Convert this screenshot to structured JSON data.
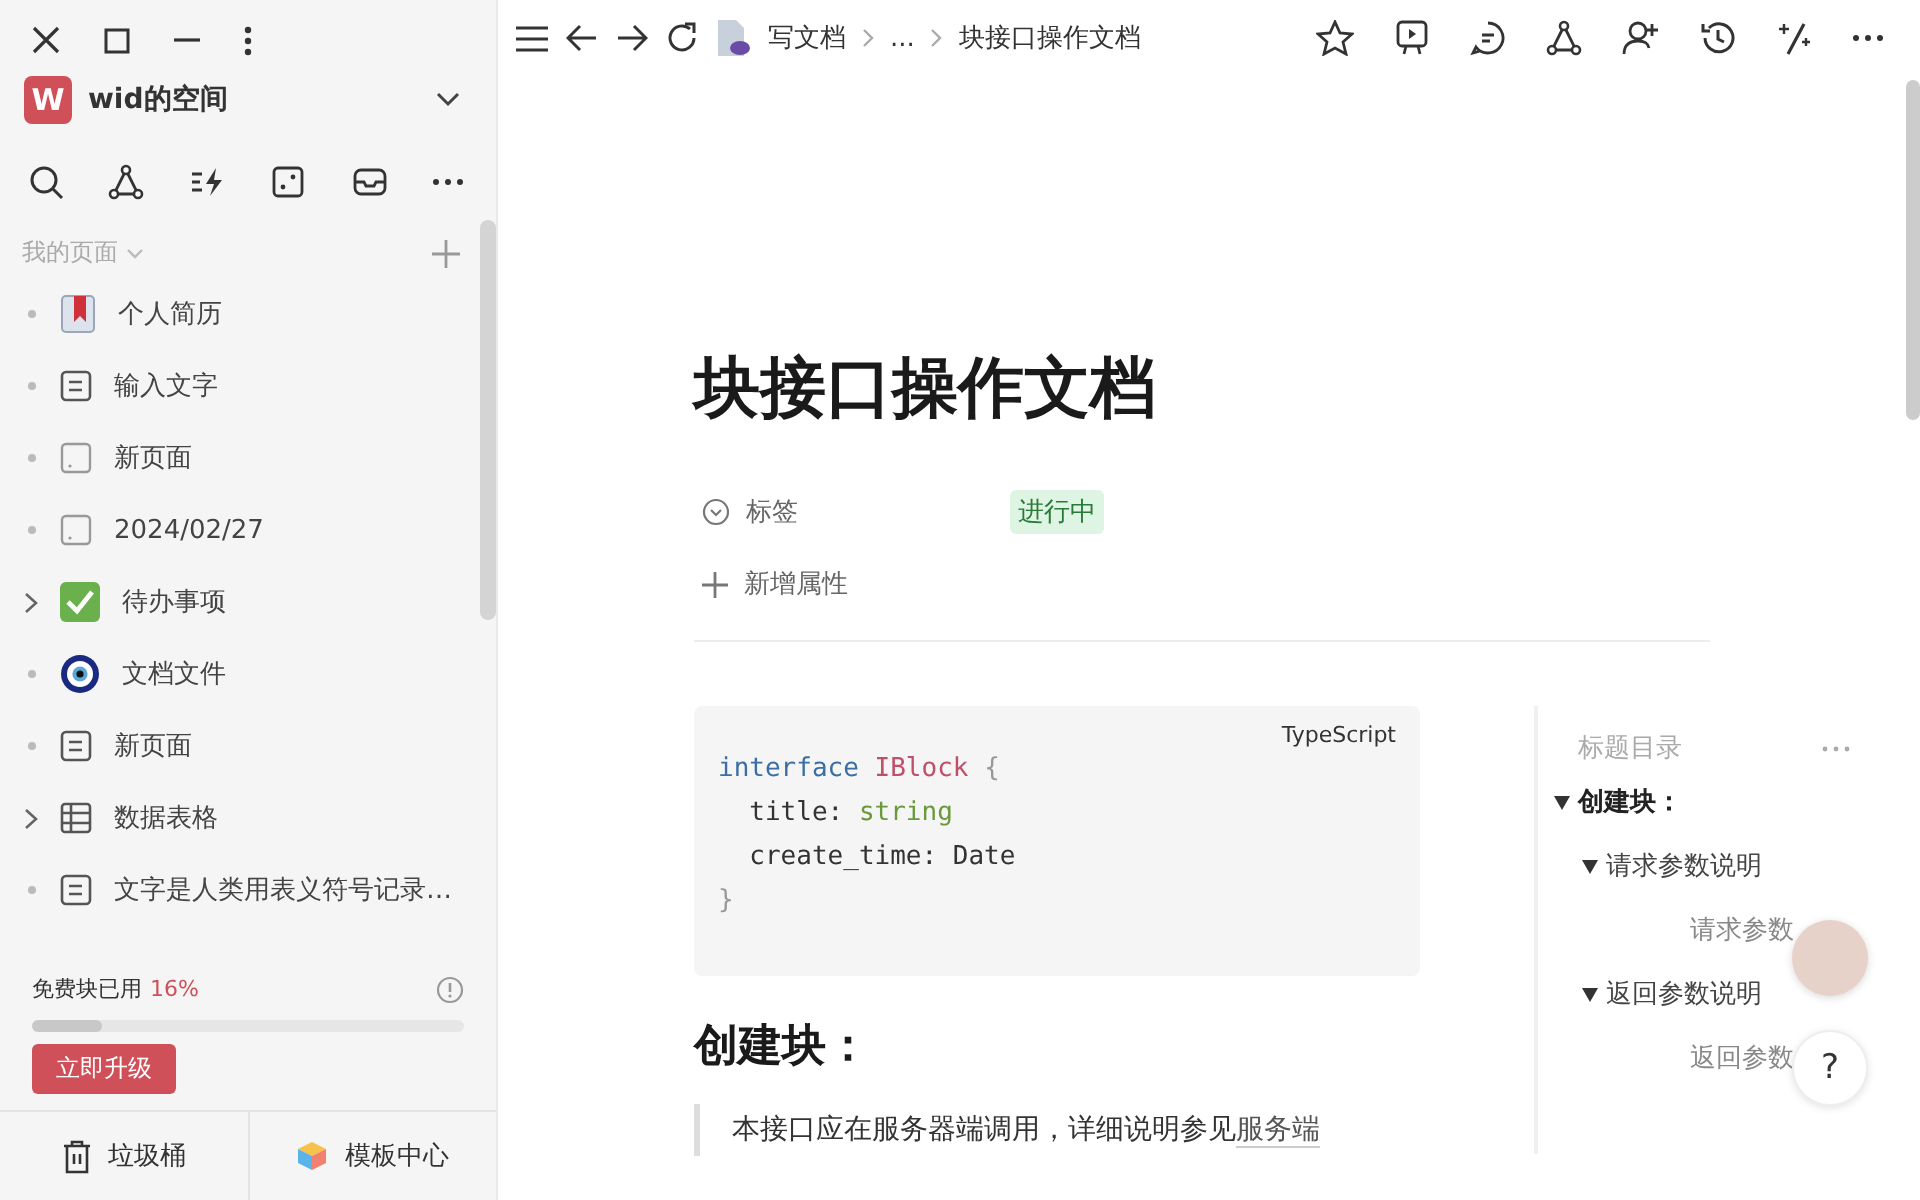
{
  "workspace": {
    "initial": "W",
    "name": "wid的空间"
  },
  "sidebar": {
    "section": "我的页面",
    "pages": [
      {
        "title": "个人简历",
        "kind": "resume",
        "has_children": false
      },
      {
        "title": "输入文字",
        "kind": "doc",
        "has_children": false
      },
      {
        "title": "新页面",
        "kind": "blank",
        "has_children": false
      },
      {
        "title": "2024/02/27",
        "kind": "blank",
        "has_children": false
      },
      {
        "title": "待办事项",
        "kind": "todo",
        "has_children": true
      },
      {
        "title": "文档文件",
        "kind": "target",
        "has_children": false
      },
      {
        "title": "新页面",
        "kind": "doc",
        "has_children": false
      },
      {
        "title": "数据表格",
        "kind": "table",
        "has_children": true
      },
      {
        "title": "文字是人类用表义符号记录…",
        "kind": "doc",
        "has_children": false
      }
    ],
    "usage": {
      "label": "免费块已用",
      "percent": "16%",
      "level": 0.16
    },
    "upgrade_button": "立即升级",
    "footer": [
      "垃圾桶",
      "模板中心"
    ]
  },
  "breadcrumb": [
    "写文档",
    "...",
    "块接口操作文档"
  ],
  "document": {
    "title": "块接口操作文档",
    "properties": [
      {
        "label": "标签",
        "value": "进行中"
      }
    ],
    "add_property": "新增属性",
    "code": {
      "language": "TypeScript",
      "lines": [
        [
          {
            "t": "interface ",
            "kind": "keyword"
          },
          {
            "t": "IBlock ",
            "kind": "type"
          },
          {
            "t": "{",
            "kind": "punct"
          }
        ],
        [
          {
            "t": "  title: ",
            "kind": "plain"
          },
          {
            "t": "string",
            "kind": "string"
          }
        ],
        [
          {
            "t": "  create_time: Date",
            "kind": "plain"
          }
        ],
        [
          {
            "t": "}",
            "kind": "punct"
          }
        ]
      ]
    },
    "heading": "创建块：",
    "quote": {
      "text": "本接口应在服务器端调用，详细说明参见",
      "link": "服务端"
    }
  },
  "toc": {
    "title": "标题目录",
    "items": [
      {
        "label": "创建块：",
        "expanded": true,
        "children": [
          {
            "label": "请求参数说明",
            "expanded": true,
            "children": [
              {
                "label": "请求参数"
              }
            ]
          },
          {
            "label": "返回参数说明",
            "expanded": true,
            "children": [
              {
                "label": "返回参数"
              }
            ]
          }
        ]
      }
    ]
  },
  "help_button": "?"
}
